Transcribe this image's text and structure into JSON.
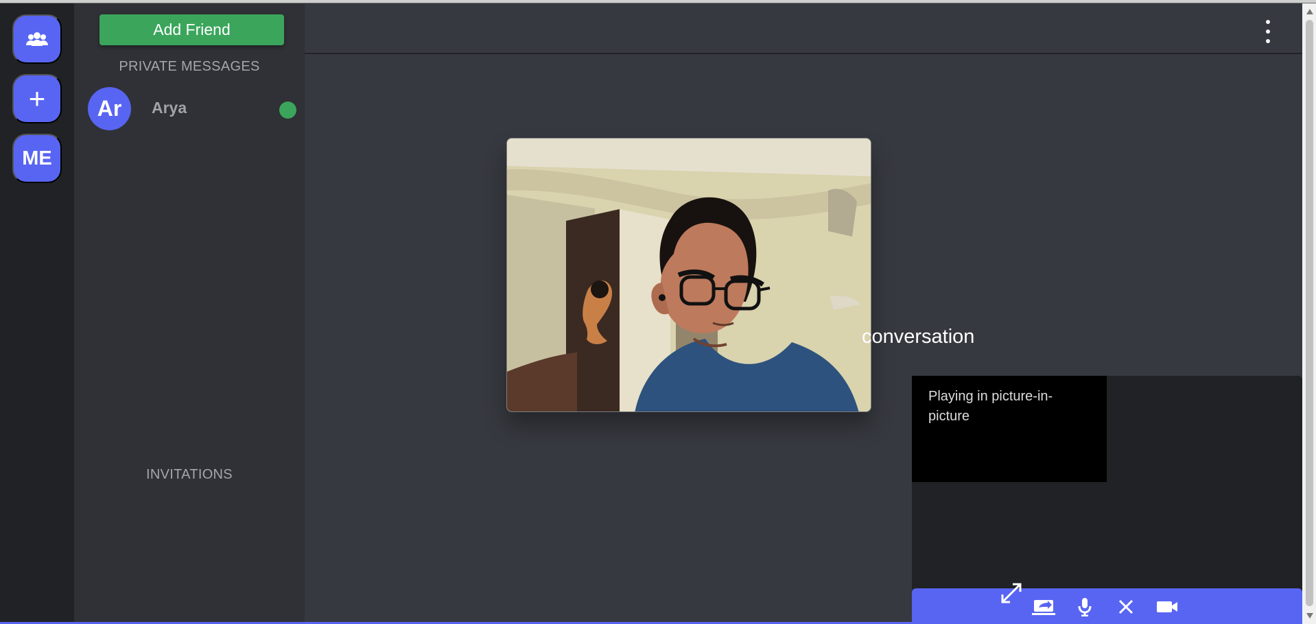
{
  "rail": {
    "friends_icon": "people-icon",
    "add_icon": "plus-icon",
    "add_label": "+",
    "me_label": "ME"
  },
  "sidebar": {
    "add_friend": "Add Friend",
    "private_messages": "PRIVATE MESSAGES",
    "invitations": "INVITATIONS",
    "friends": [
      {
        "initials": "Ar",
        "name": "Arya",
        "status": "online"
      }
    ]
  },
  "main": {
    "conversation_text": "conversation",
    "pip_text": "Playing in picture-in-picture"
  },
  "call_controls": {
    "share_screen_icon": "share-screen-icon",
    "microphone_icon": "microphone-icon",
    "close_icon": "close-icon",
    "camera_icon": "camera-icon",
    "expand_icon": "expand-icon"
  },
  "colors": {
    "accent": "#5865f2",
    "success": "#3ba55c",
    "background": "#36393f",
    "sidebar": "#2f3136",
    "rail": "#202225"
  }
}
